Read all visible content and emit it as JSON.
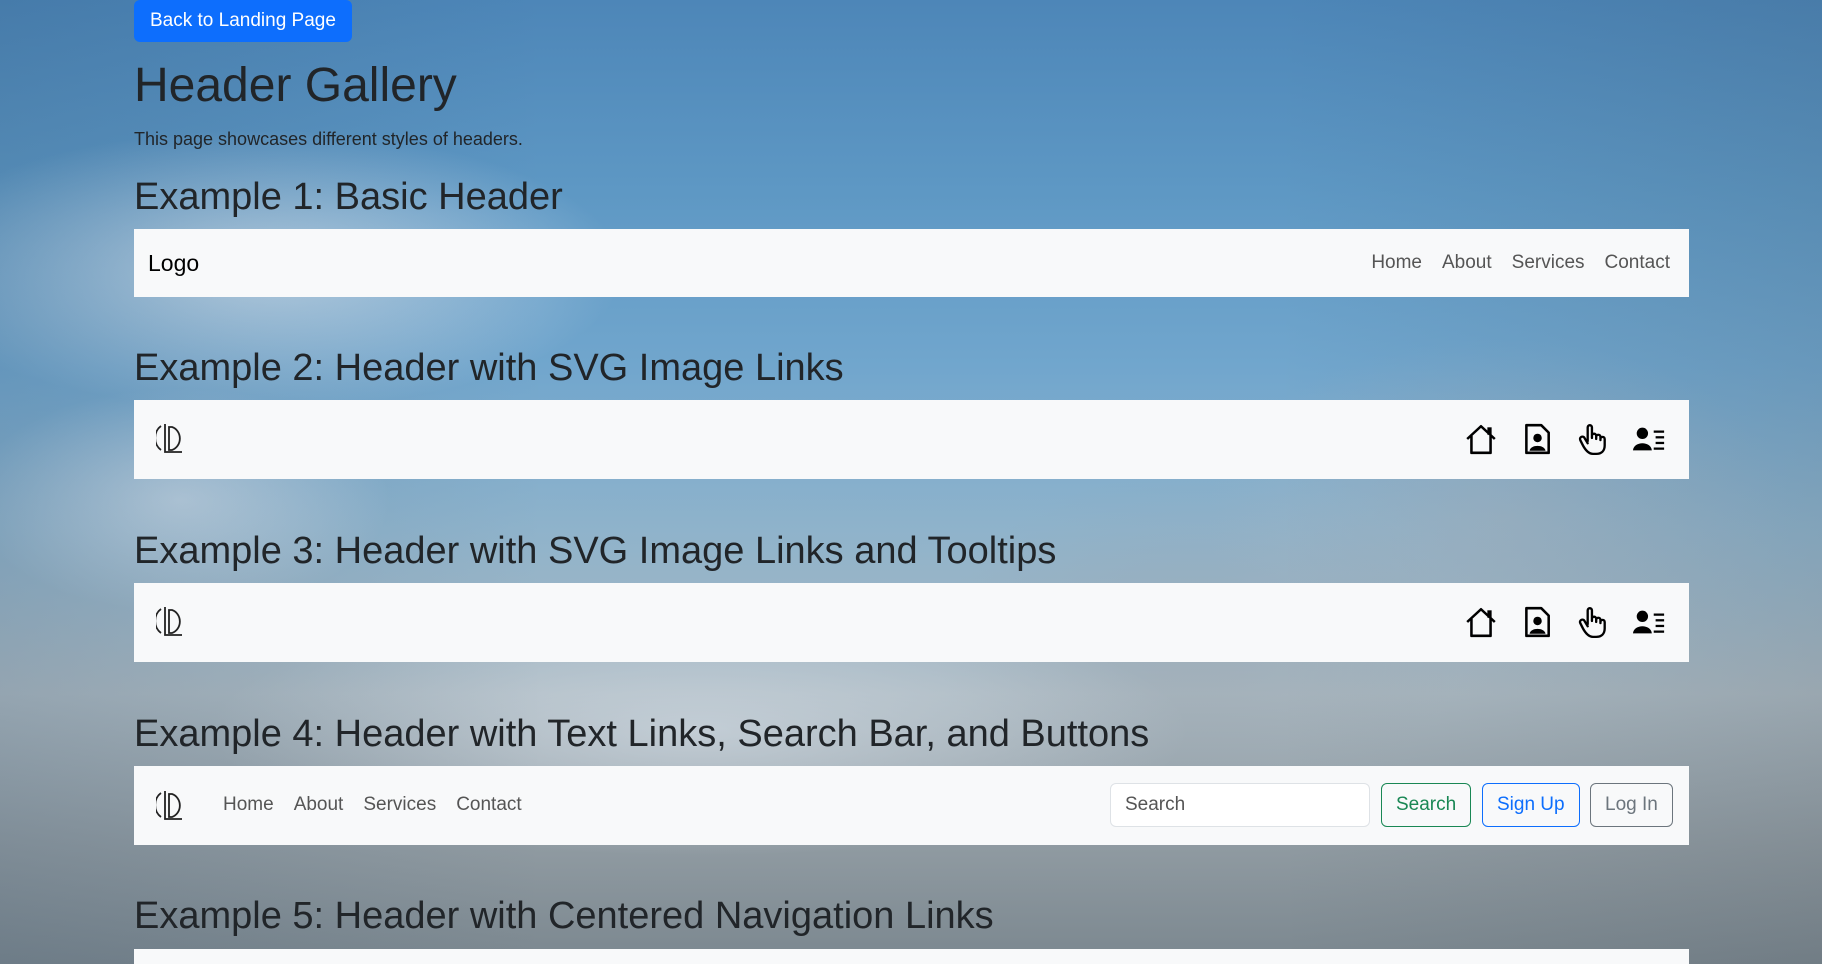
{
  "back_button": "Back to Landing Page",
  "title": "Header Gallery",
  "lead": "This page showcases different styles of headers.",
  "examples": [
    {
      "heading": "Example 1: Basic Header",
      "brand": "Logo",
      "links": [
        "Home",
        "About",
        "Services",
        "Contact"
      ]
    },
    {
      "heading": "Example 2: Header with SVG Image Links",
      "icons": [
        "home-icon",
        "person-document-icon",
        "hand-pointer-icon",
        "person-lines-icon"
      ]
    },
    {
      "heading": "Example 3: Header with SVG Image Links and Tooltips",
      "icons": [
        "home-icon",
        "person-document-icon",
        "hand-pointer-icon",
        "person-lines-icon"
      ]
    },
    {
      "heading": "Example 4: Header with Text Links, Search Bar, and Buttons",
      "links": [
        "Home",
        "About",
        "Services",
        "Contact"
      ],
      "search_placeholder": "Search",
      "search_button": "Search",
      "signup_button": "Sign Up",
      "login_button": "Log In"
    },
    {
      "heading": "Example 5: Header with Centered Navigation Links"
    }
  ],
  "colors": {
    "primary": "#0d6efd",
    "success": "#198754",
    "secondary": "#6c757d",
    "navbar_bg": "#f8f9fa"
  }
}
